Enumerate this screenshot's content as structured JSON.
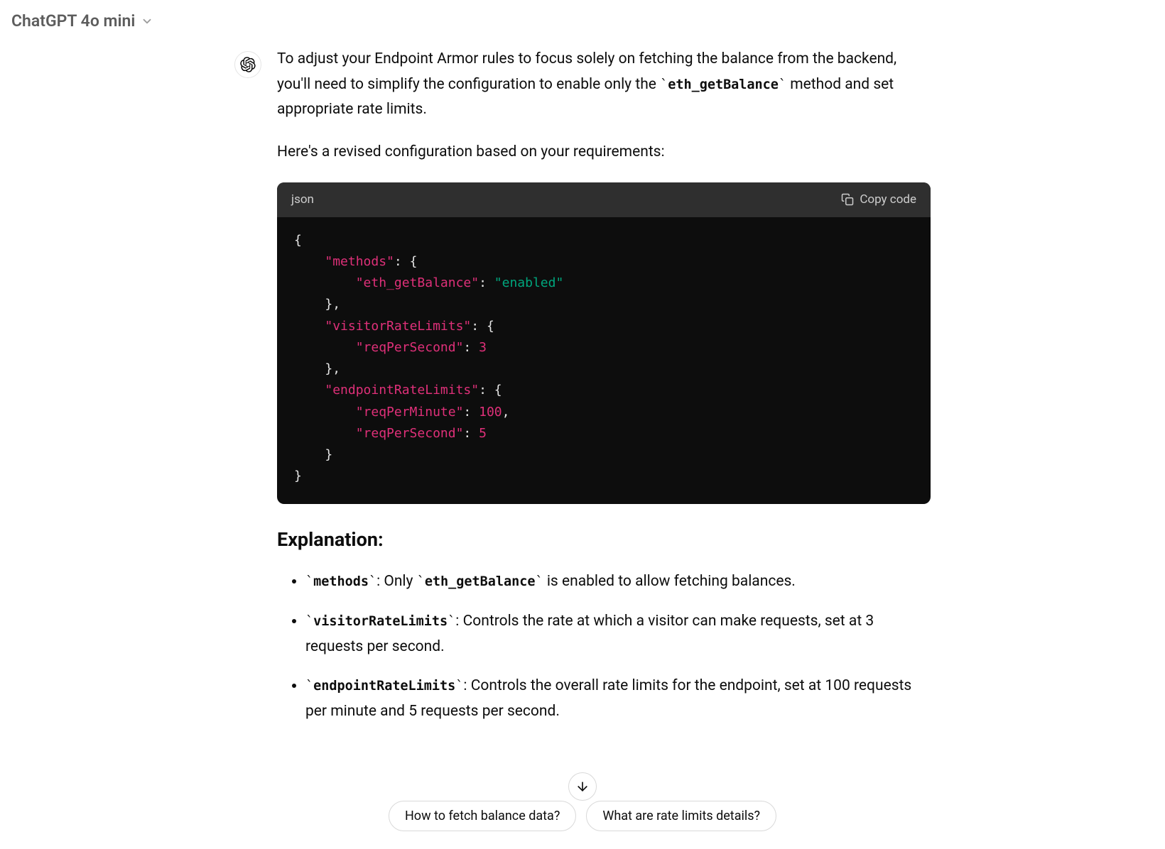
{
  "header": {
    "model_label": "ChatGPT 4o mini"
  },
  "message": {
    "intro_part1": "To adjust your Endpoint Armor rules to focus solely on fetching the balance from the backend, you'll need to simplify the configuration to enable only the ",
    "intro_inline_code": "eth_getBalance",
    "intro_part2": " method and set appropriate rate limits.",
    "intro_line2": "Here's a revised configuration based on your requirements:"
  },
  "codeblock": {
    "language": "json",
    "copy_label": "Copy code",
    "tokens": {
      "k_methods": "\"methods\"",
      "k_eth": "\"eth_getBalance\"",
      "v_enabled": "\"enabled\"",
      "k_visitor": "\"visitorRateLimits\"",
      "k_reqPerSecond": "\"reqPerSecond\"",
      "v_3": "3",
      "k_endpoint": "\"endpointRateLimits\"",
      "k_reqPerMinute": "\"reqPerMinute\"",
      "v_100": "100",
      "v_5": "5"
    }
  },
  "explanation": {
    "heading": "Explanation:",
    "items": [
      {
        "code": "methods",
        "text": ": Only ",
        "code2": "eth_getBalance",
        "text2": " is enabled to allow fetching balances."
      },
      {
        "code": "visitorRateLimits",
        "text": ": Controls the rate at which a visitor can make requests, set at 3 requests per second.",
        "code2": "",
        "text2": ""
      },
      {
        "code": "endpointRateLimits",
        "text": ": Controls the overall rate limits for the endpoint, set at 100 requests per minute and 5 requests per second.",
        "code2": "",
        "text2": ""
      }
    ]
  },
  "suggestions": [
    "How to fetch balance data?",
    "What are rate limits details?"
  ]
}
